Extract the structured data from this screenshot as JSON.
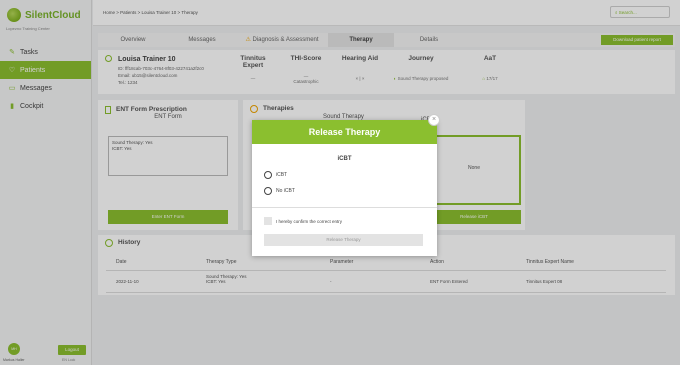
{
  "brand": {
    "name": "SilentCloud",
    "sub": "Lopezno Training Center"
  },
  "sidebar": {
    "items": [
      {
        "label": "Tasks",
        "icon": "tasks-icon",
        "active": false
      },
      {
        "label": "Patients",
        "icon": "patients-icon",
        "active": true
      },
      {
        "label": "Messages",
        "icon": "messages-icon",
        "active": false
      },
      {
        "label": "Cockpit",
        "icon": "cockpit-icon",
        "active": false
      }
    ],
    "avatar": "MH",
    "user_name": "Markus Haller",
    "logout": "Logout",
    "lang": "EN  Lock"
  },
  "topbar": {
    "breadcrumb": "Home > Patients > Louisa Trainer 10 > Therapy",
    "search_placeholder": "Search..."
  },
  "tabs": [
    "Overview",
    "Messages",
    "Diagnosis & Assessment",
    "Therapy",
    "Details"
  ],
  "active_tab": "Therapy",
  "download_label": "Download patient report",
  "patient": {
    "name": "Louisa Trainer 10",
    "id": "ID: fff18cab-703c-4764-8f03-422741a2f2c0",
    "email": "Email: ub15@silentcloud.com",
    "tel": "Tel.: 1234",
    "cols": [
      {
        "h": "Tinnitus Expert",
        "v": "—"
      },
      {
        "h": "THI-Score",
        "v": "—",
        "v2": "Catastrophic"
      },
      {
        "h": "Hearing Aid",
        "v": "×  |  ×"
      },
      {
        "h": "Journey",
        "v": "Sound Therapy proposed"
      },
      {
        "h": "AaT",
        "v": "17/17"
      }
    ]
  },
  "ent_card": {
    "title": "ENT Form Prescription",
    "subtitle": "ENT Form",
    "box_line1": "Sound Therapy: Yes",
    "box_line2": "ICBT: Yes",
    "button": "Enter ENT Form"
  },
  "therapies_card": {
    "title": "Therapies",
    "sound_therapy": "Sound Therapy",
    "icbt": "iCBT",
    "none": "None",
    "release_button": "Release iCBT"
  },
  "history": {
    "title": "History",
    "headers": [
      "Date",
      "Therapy Type",
      "Parameter",
      "Action",
      "Tinnitus Expert Name"
    ],
    "rows": [
      {
        "date": "2022-11-10",
        "type1": "Sound Therapy: Yes",
        "type2": "ICBT: Yes",
        "param": "-",
        "action": "ENT Form Entered",
        "expert": "Tinnitus Expert 08"
      }
    ]
  },
  "modal": {
    "title": "Release Therapy",
    "subtitle": "iCBT",
    "options": [
      "iCBT",
      "No iCBT"
    ],
    "confirm": "I hereby confirm the correct entry",
    "button": "Release Therapy"
  },
  "colors": {
    "accent": "#8bbf2f",
    "warning": "#f0a500"
  }
}
